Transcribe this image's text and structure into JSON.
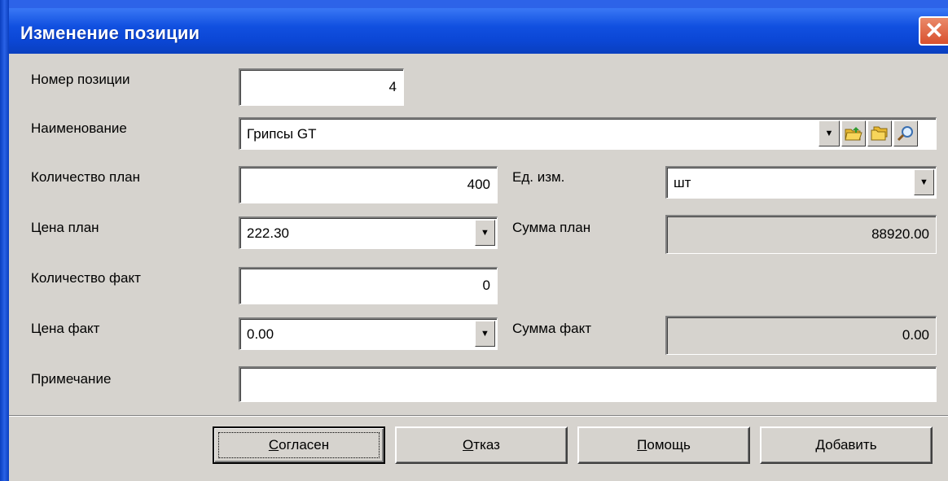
{
  "window": {
    "title": "Изменение позиции",
    "close_glyph": "✕"
  },
  "labels": {
    "position_number": "Номер позиции",
    "name": "Наименование",
    "qty_plan": "Количество план",
    "unit": "Ед. изм.",
    "price_plan": "Цена план",
    "sum_plan": "Сумма план",
    "qty_fact": "Количество факт",
    "price_fact": "Цена факт",
    "sum_fact": "Сумма факт",
    "note": "Примечание"
  },
  "values": {
    "position_number": "4",
    "name": "Грипсы GT",
    "qty_plan": "400",
    "unit": "шт",
    "price_plan": "222.30",
    "sum_plan": "88920.00",
    "qty_fact": "0",
    "price_fact": "0.00",
    "sum_fact": "0.00",
    "note": ""
  },
  "name_tools": [
    "dropdown-arrow-icon",
    "folder-open-icon",
    "folders-icon",
    "magnifier-icon"
  ],
  "buttons": {
    "ok": {
      "mnemonic": "С",
      "rest": "огласен"
    },
    "cancel": {
      "mnemonic": "О",
      "rest": "тказ"
    },
    "help": {
      "mnemonic": "П",
      "rest": "омощь"
    },
    "add": {
      "mnemonic": "Д",
      "rest": "обавить"
    }
  },
  "colors": {
    "titlebar": "#0b47d6",
    "close": "#d8502e",
    "face": "#d6d3ce"
  }
}
